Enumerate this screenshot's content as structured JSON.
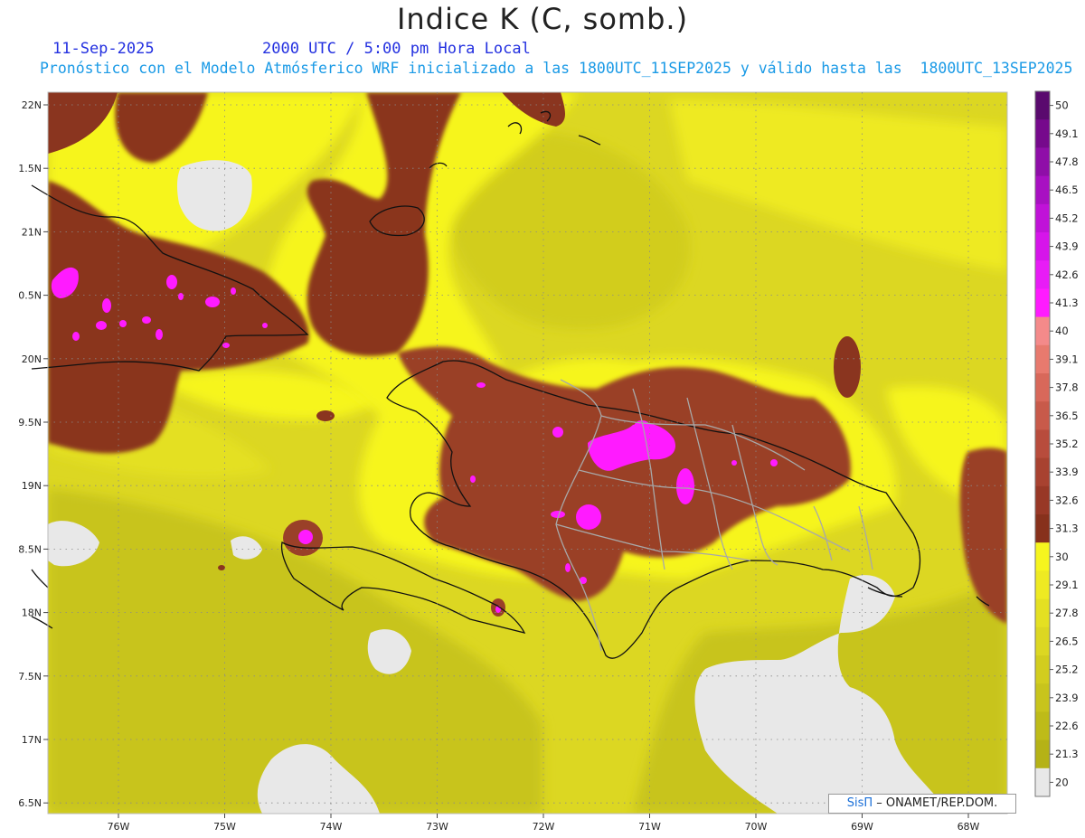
{
  "header": {
    "title": "Indice K (C, somb.)",
    "date": "11-Sep-2025",
    "time": "2000 UTC / 5:00 pm Hora Local",
    "description": "Pronóstico con el Modelo Atmósferico WRF inicializado a las 1800UTC_11SEP2025 y válido hasta las  1800UTC_13SEP2025"
  },
  "axes": {
    "lat_labels": [
      "22N",
      "1.5N",
      "21N",
      "0.5N",
      "20N",
      "9.5N",
      "19N",
      "8.5N",
      "18N",
      "7.5N",
      "17N",
      "6.5N"
    ],
    "lon_labels": [
      "76W",
      "75W",
      "74W",
      "73W",
      "72W",
      "71W",
      "70W",
      "69W",
      "68W"
    ]
  },
  "colorbar": {
    "levels": [
      "50",
      "49.1",
      "47.8",
      "46.5",
      "45.2",
      "43.9",
      "42.6",
      "41.3",
      "40",
      "39.1",
      "37.8",
      "36.5",
      "35.2",
      "33.9",
      "32.6",
      "31.3",
      "30",
      "29.1",
      "27.8",
      "26.5",
      "25.2",
      "23.9",
      "22.6",
      "21.3",
      "20"
    ],
    "colors": [
      "#5a0a6e",
      "#76098c",
      "#8f0ea8",
      "#a810c2",
      "#c012d8",
      "#d615ea",
      "#e81cf6",
      "#ff1bff",
      "#f48a8a",
      "#e87a6e",
      "#d8685a",
      "#c85a4a",
      "#b84c3c",
      "#a84230",
      "#983826",
      "#87311c",
      "#f6f51e",
      "#eeea22",
      "#e4e022",
      "#dcd722",
      "#d2cd1e",
      "#c8c41c",
      "#bebb18",
      "#b5b216",
      "#e8e8e8"
    ]
  },
  "credit": {
    "brand": "SisΠ",
    "text": " – ONAMET/REP.DOM."
  }
}
